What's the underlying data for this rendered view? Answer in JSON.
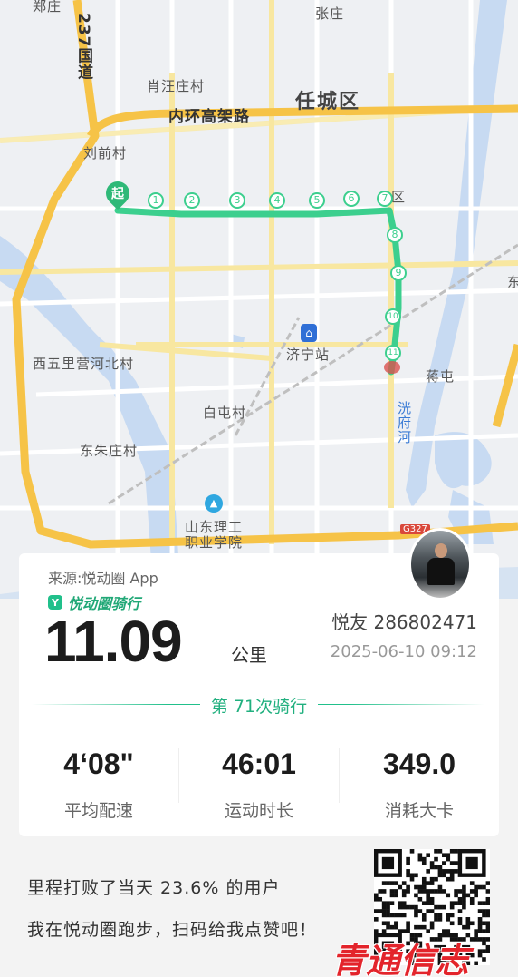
{
  "map": {
    "labels": {
      "zhengzhuang": "郑庄",
      "g237": "237国道",
      "zhangzhuang": "张庄",
      "xiaowangzhuangcun": "肖汪庄村",
      "rencheng": "任城区",
      "neihuan": "内环高架路",
      "liuqiancun": "刘前村",
      "qu": "区",
      "xiwulibei": "西五里营河北村",
      "jiningzhan": "济宁站",
      "jiangtun": "蒋屯",
      "baituncun": "白屯村",
      "dongzhucun": "东朱庄村",
      "taofuhe": "洸府河",
      "shandong": "山东理工",
      "zhiye": "职业学院",
      "g327": "G327",
      "east": "东"
    },
    "start_marker": "起",
    "km_markers": [
      "1",
      "2",
      "3",
      "4",
      "5",
      "6",
      "7",
      "8",
      "9",
      "10",
      "11"
    ]
  },
  "card": {
    "source": "来源:悦动圈 App",
    "brand_logo": "Y",
    "brand_name": "悦动圈骑行",
    "distance": "11.09",
    "unit": "公里",
    "username": "悦友 286802471",
    "datetime": "2025-06-10 09:12",
    "ride_count": "第 71次骑行",
    "stats": [
      {
        "value": "4‘08\"",
        "label": "平均配速"
      },
      {
        "value": "46:01",
        "label": "运动时长"
      },
      {
        "value": "349.0",
        "label": "消耗大卡"
      }
    ]
  },
  "bottom": {
    "line1": "里程打败了当天 23.6% 的用户",
    "line2": "我在悦动圈跑步，扫码给我点赞吧！",
    "watermark": "青通信志"
  },
  "colors": {
    "route": "#3ccf8e",
    "accent": "#21c08b",
    "highway": "#f6c347",
    "water": "#bcd4f0"
  }
}
